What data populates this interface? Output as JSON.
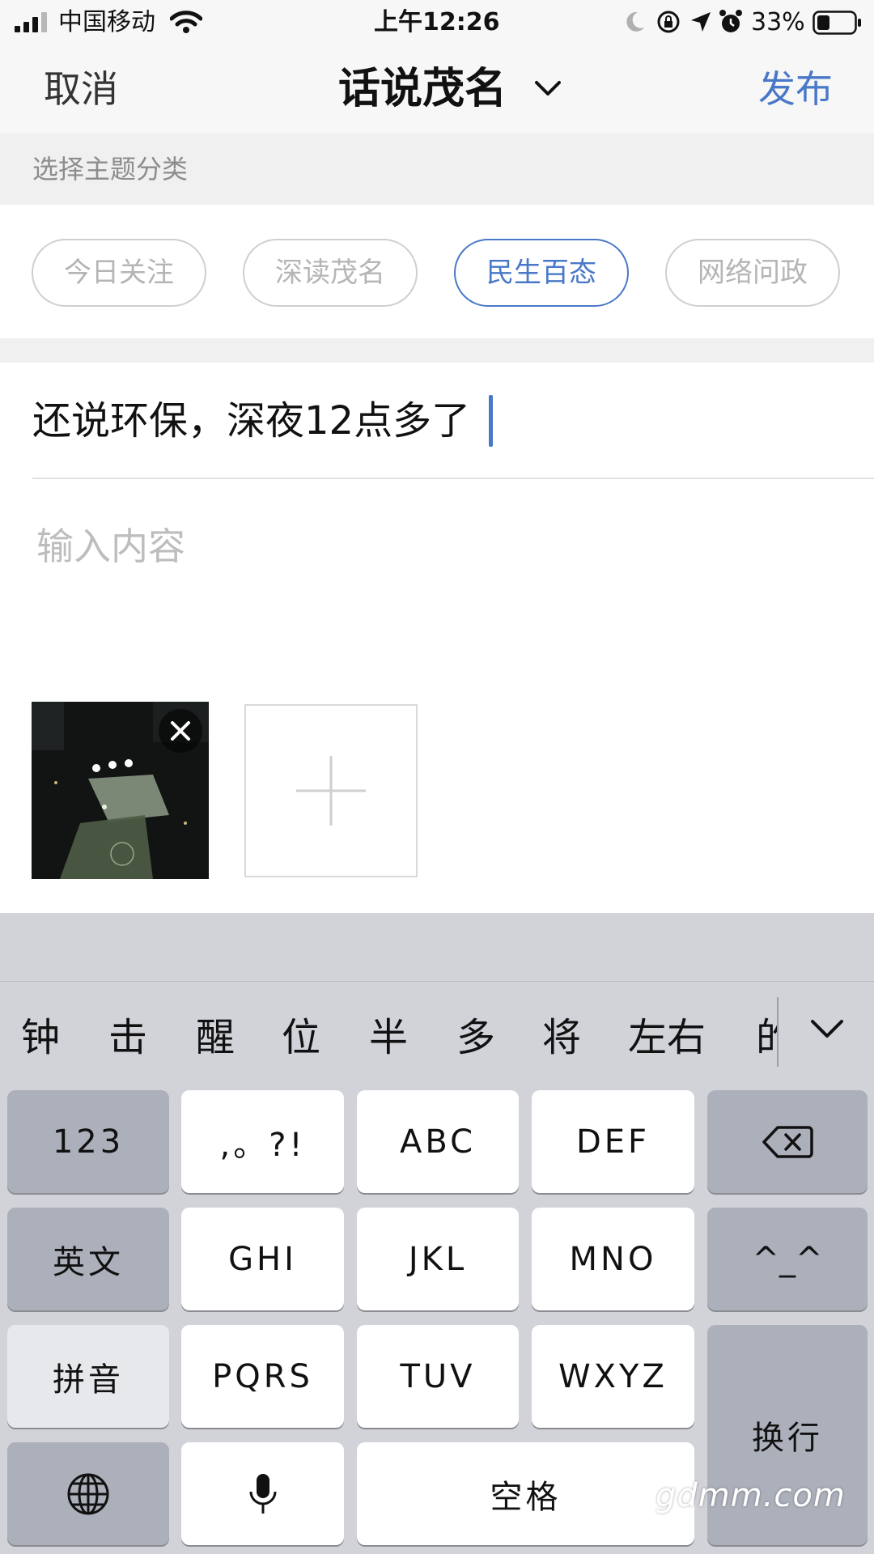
{
  "status_bar": {
    "carrier": "中国移动",
    "time": "上午12:26",
    "battery": "33%",
    "icons": [
      "signal-icon",
      "wifi-icon",
      "moon-icon",
      "rotation-lock-icon",
      "location-icon",
      "alarm-icon",
      "battery-icon"
    ]
  },
  "nav": {
    "cancel": "取消",
    "title": "话说茂名",
    "publish": "发布",
    "accent": "#4a78c8"
  },
  "section": {
    "label": "选择主题分类"
  },
  "categories": {
    "items": [
      "今日关注",
      "深读茂名",
      "民生百态",
      "网络问政"
    ],
    "selected": "民生百态"
  },
  "post": {
    "title_value": "还说环保，深夜12点多了",
    "content_placeholder": "输入内容"
  },
  "keyboard": {
    "candidates": [
      "钟",
      "击",
      "醒",
      "位",
      "半",
      "多",
      "将",
      "左右",
      "的"
    ],
    "rows": [
      [
        "123",
        ",。?!",
        "ABC",
        "DEF",
        "delete-icon"
      ],
      [
        "英文",
        "GHI",
        "JKL",
        "MNO",
        "^_^"
      ],
      [
        "拼音",
        "PQRS",
        "TUV",
        "WXYZ",
        "换行"
      ],
      [
        "globe-icon",
        "microphone-icon",
        "空格"
      ]
    ],
    "key_123": "123",
    "key_punct": ",。?!",
    "key_abc": "ABC",
    "key_def": "DEF",
    "key_english": "英文",
    "key_ghi": "GHI",
    "key_jkl": "JKL",
    "key_mno": "MNO",
    "key_emoticon": "^_^",
    "key_pinyin": "拼音",
    "key_pqrs": "PQRS",
    "key_tuv": "TUV",
    "key_wxyz": "WXYZ",
    "key_return": "换行",
    "key_space": "空格"
  },
  "watermark": "gdmm.com"
}
